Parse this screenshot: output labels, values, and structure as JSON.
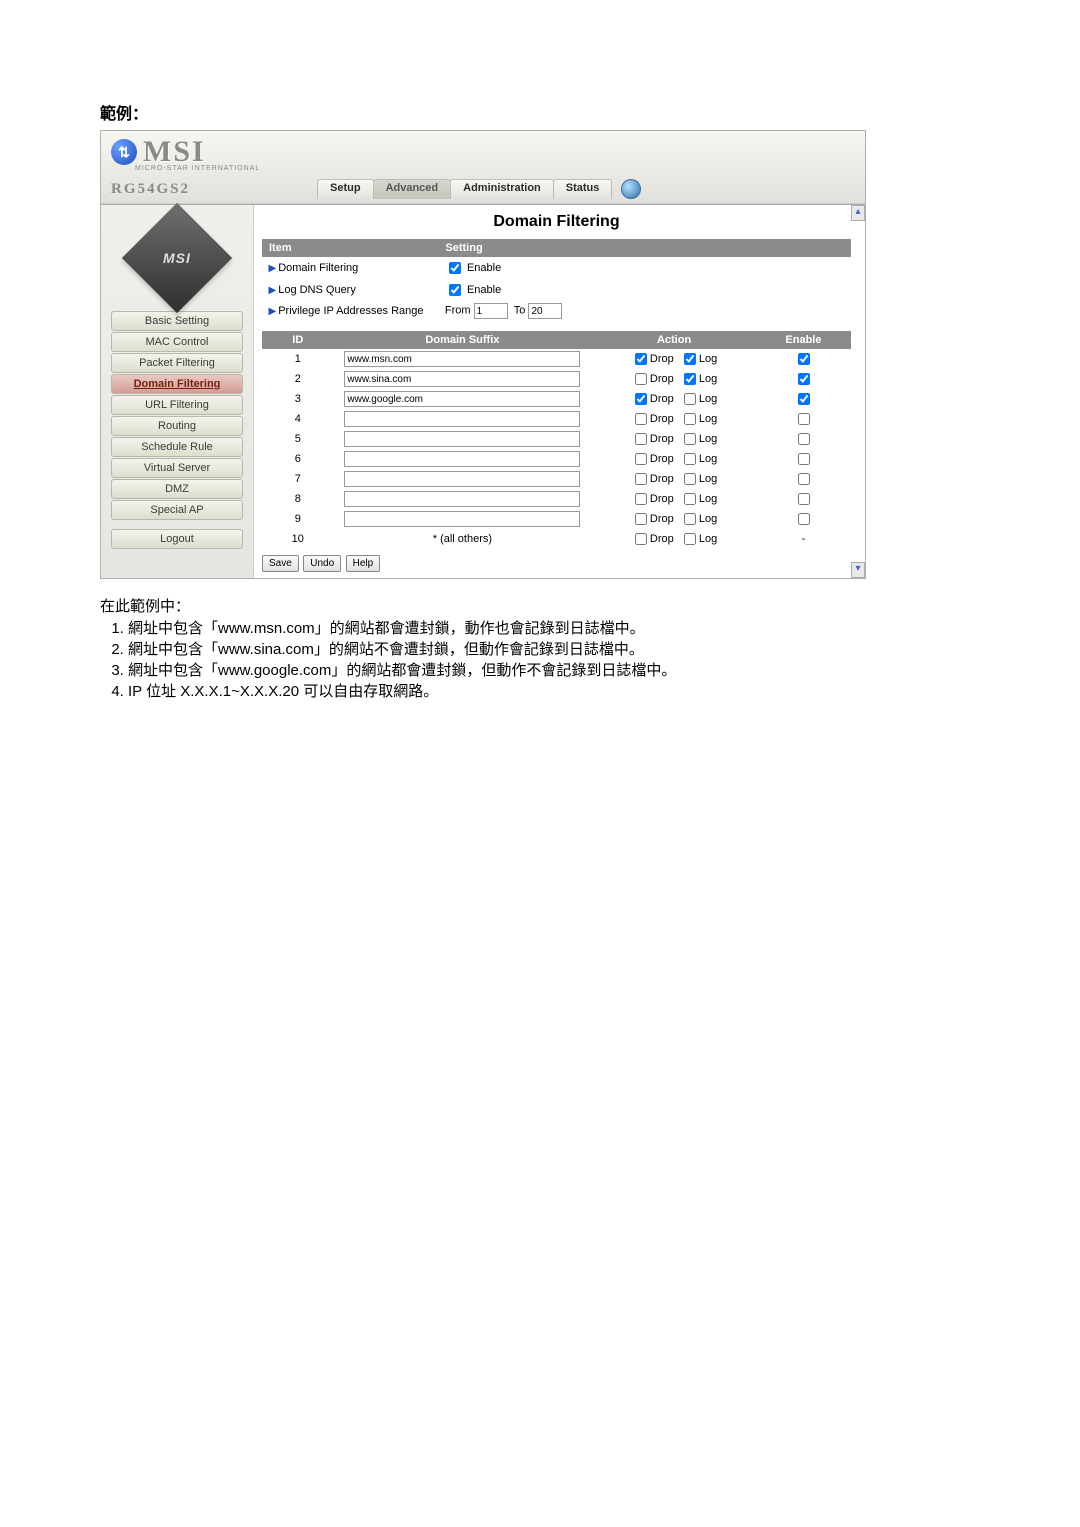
{
  "doc": {
    "title": "範例：",
    "notes_intro": "在此範例中：",
    "notes": [
      "網址中包含「www.msn.com」的網站都會遭封鎖，動作也會記錄到日誌檔中。",
      "網址中包含「www.sina.com」的網站不會遭封鎖，但動作會記錄到日誌檔中。",
      "網址中包含「www.google.com」的網站都會遭封鎖，但動作不會記錄到日誌檔中。",
      "IP 位址 X.X.X.1~X.X.X.20 可以自由存取網路。"
    ]
  },
  "header": {
    "logo_text": "MSI",
    "logo_sub": "MICRO-STAR INTERNATIONAL",
    "model": "RG54GS2",
    "tabs": [
      "Setup",
      "Advanced",
      "Administration",
      "Status"
    ],
    "active_tab": 1
  },
  "sidebar": {
    "diamond": "MSI",
    "items": [
      "Basic Setting",
      "MAC Control",
      "Packet Filtering",
      "Domain Filtering",
      "URL Filtering",
      "Routing",
      "Schedule Rule",
      "Virtual Server",
      "DMZ",
      "Special AP"
    ],
    "active": 3,
    "logout": "Logout"
  },
  "page": {
    "title": "Domain Filtering",
    "col_item": "Item",
    "col_setting": "Setting",
    "row1_label": "Domain Filtering",
    "row1_enable_label": "Enable",
    "row1_enable": true,
    "row2_label": "Log DNS Query",
    "row2_enable_label": "Enable",
    "row2_enable": true,
    "row3_label": "Privilege IP Addresses Range",
    "row3_from_label": "From",
    "row3_from": "1",
    "row3_to_label": "To",
    "row3_to": "20",
    "th_id": "ID",
    "th_suffix": "Domain Suffix",
    "th_action": "Action",
    "th_enable": "Enable",
    "action_drop": "Drop",
    "action_log": "Log",
    "rows": [
      {
        "id": "1",
        "suffix": "www.msn.com",
        "drop": true,
        "log": true,
        "enable": true
      },
      {
        "id": "2",
        "suffix": "www.sina.com",
        "drop": false,
        "log": true,
        "enable": true
      },
      {
        "id": "3",
        "suffix": "www.google.com",
        "drop": true,
        "log": false,
        "enable": true
      },
      {
        "id": "4",
        "suffix": "",
        "drop": false,
        "log": false,
        "enable": false
      },
      {
        "id": "5",
        "suffix": "",
        "drop": false,
        "log": false,
        "enable": false
      },
      {
        "id": "6",
        "suffix": "",
        "drop": false,
        "log": false,
        "enable": false
      },
      {
        "id": "7",
        "suffix": "",
        "drop": false,
        "log": false,
        "enable": false
      },
      {
        "id": "8",
        "suffix": "",
        "drop": false,
        "log": false,
        "enable": false
      },
      {
        "id": "9",
        "suffix": "",
        "drop": false,
        "log": false,
        "enable": false
      }
    ],
    "all_others_id": "10",
    "all_others": "* (all others)",
    "all_others_drop": false,
    "all_others_log": false,
    "btn_save": "Save",
    "btn_undo": "Undo",
    "btn_help": "Help"
  }
}
